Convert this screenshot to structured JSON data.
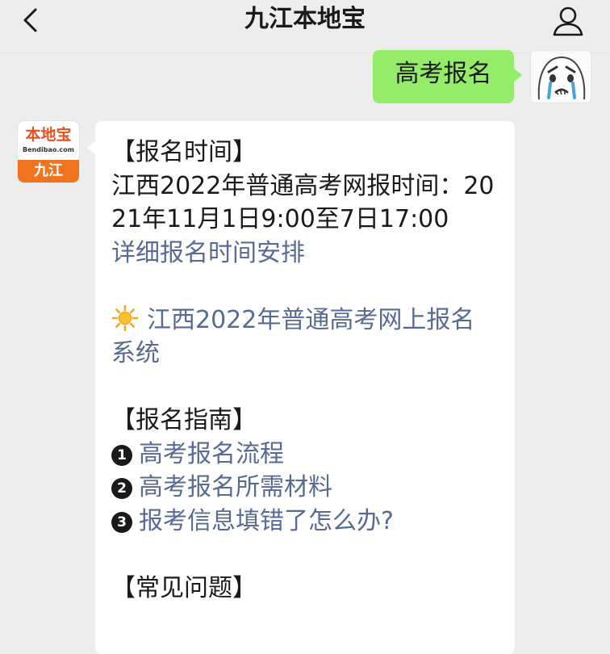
{
  "header": {
    "title": "九江本地宝",
    "back_icon": "chevron-left-icon",
    "profile_icon": "person-icon"
  },
  "user_message": {
    "text": "高考报名"
  },
  "bot": {
    "avatar": {
      "logo_text": "本地宝",
      "logo_sub": "Bendibao.com",
      "city": "九江"
    },
    "message": {
      "signup_time_heading": "【报名时间】",
      "signup_time_text": "江西2022年普通高考网报时间：2021年11月1日9:00至7日17:00",
      "signup_time_link": "详细报名时间安排",
      "system_link": "江西2022年普通高考网上报名系统",
      "guide_heading": "【报名指南】",
      "guide_items": [
        {
          "number": "1",
          "label": "高考报名流程"
        },
        {
          "number": "2",
          "label": "高考报名所需材料"
        },
        {
          "number": "3",
          "label": "报考信息填错了怎么办?"
        }
      ],
      "faq_heading": "【常见问题】"
    }
  },
  "colors": {
    "background": "#ededed",
    "user_bubble": "#95ec69",
    "link": "#576b95",
    "logo_orange": "#f0731f"
  }
}
